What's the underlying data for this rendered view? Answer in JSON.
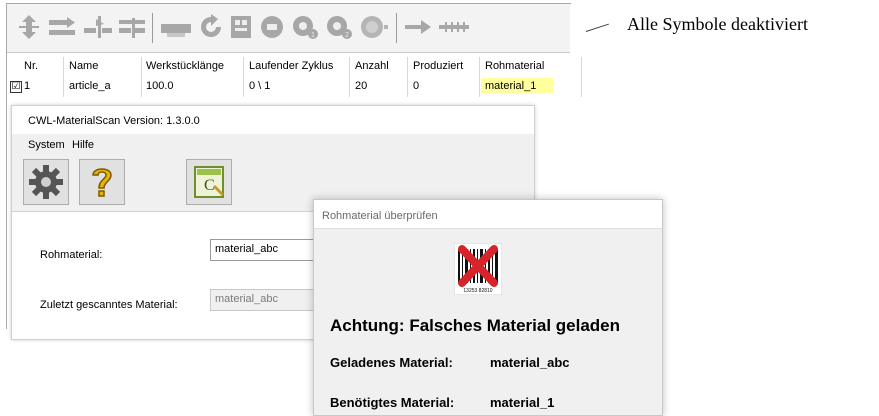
{
  "annotation": {
    "text": "Alle Symbole deaktiviert"
  },
  "toolbar": {
    "icons": [
      "move-vertical-icon",
      "move-right-icon",
      "split-right-icon",
      "split-left-icon",
      "cut-icon",
      "rotate-icon",
      "stack-icon",
      "stop-icon",
      "zoom-1-icon",
      "zoom-2-icon",
      "disabled-circle-icon",
      "arrow-right-icon",
      "arrows-right-icon"
    ]
  },
  "grid": {
    "headers": [
      "Nr.",
      "Name",
      "Werkstücklänge",
      "Laufender Zyklus",
      "Anzahl",
      "Produziert",
      "Rohmaterial"
    ],
    "rows": [
      {
        "checked": "☑",
        "cells": [
          "1",
          "article_a",
          "100.0",
          "0 \\ 1",
          "20",
          "0",
          "material_1"
        ]
      }
    ],
    "highlight_color": "#ffff9e"
  },
  "materialscan": {
    "title": "CWL-MaterialScan   Version: 1.3.0.0",
    "menu": [
      "System",
      "Hilfe"
    ],
    "buttons": [
      "settings-icon",
      "help-icon",
      "calculator-icon"
    ],
    "raw_material_label": "Rohmaterial:",
    "raw_material_value": "material_abc",
    "last_scanned_label": "Zuletzt gescanntes Material:",
    "last_scanned_value": "material_abc"
  },
  "popup": {
    "title": "Rohmaterial überprüfen",
    "warning": "Achtung: Falsches Material geladen",
    "loaded_label": "Geladenes Material:",
    "loaded_value": "material_abc",
    "required_label": "Benötigtes Material:",
    "required_value": "material_1",
    "barcode_digits": "13253 82810",
    "error_color": "#d6242a"
  }
}
